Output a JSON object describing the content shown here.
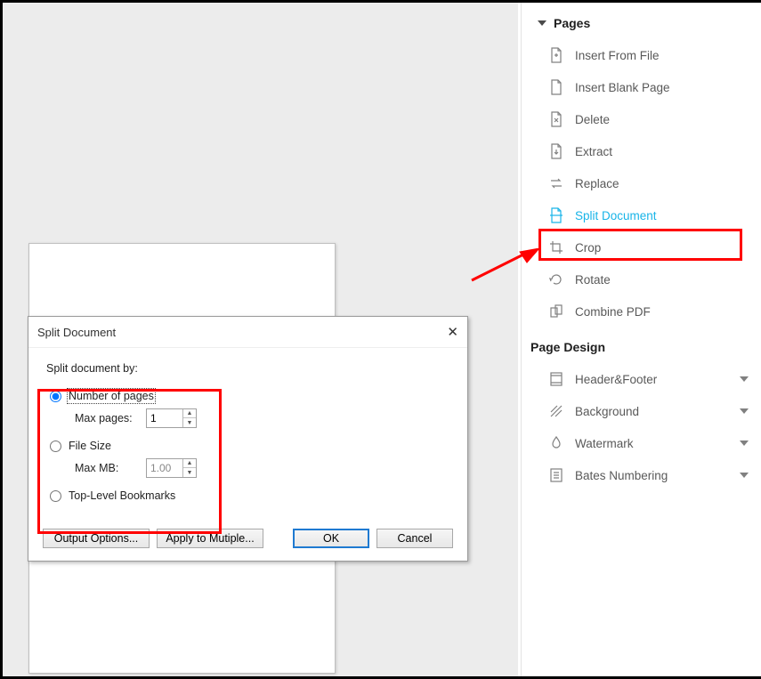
{
  "sidebar": {
    "sections": [
      {
        "title": "Pages"
      },
      {
        "title": "Page Design"
      }
    ],
    "pages_items": [
      {
        "label": "Insert From File"
      },
      {
        "label": "Insert Blank Page"
      },
      {
        "label": "Delete"
      },
      {
        "label": "Extract"
      },
      {
        "label": "Replace"
      },
      {
        "label": "Split Document"
      },
      {
        "label": "Crop"
      },
      {
        "label": "Rotate"
      },
      {
        "label": "Combine PDF"
      }
    ],
    "design_items": [
      {
        "label": "Header&Footer"
      },
      {
        "label": "Background"
      },
      {
        "label": "Watermark"
      },
      {
        "label": "Bates Numbering"
      }
    ]
  },
  "dialog": {
    "title": "Split Document",
    "close": "✕",
    "prompt": "Split document by:",
    "opts": {
      "num_pages": "Number of pages",
      "max_pages": "Max pages:",
      "max_pages_value": "1",
      "file_size": "File Size",
      "max_mb": "Max MB:",
      "max_mb_value": "1.00",
      "bookmarks": "Top-Level Bookmarks"
    },
    "buttons": {
      "output": "Output Options...",
      "apply": "Apply to Mutiple...",
      "ok": "OK",
      "cancel": "Cancel"
    }
  }
}
